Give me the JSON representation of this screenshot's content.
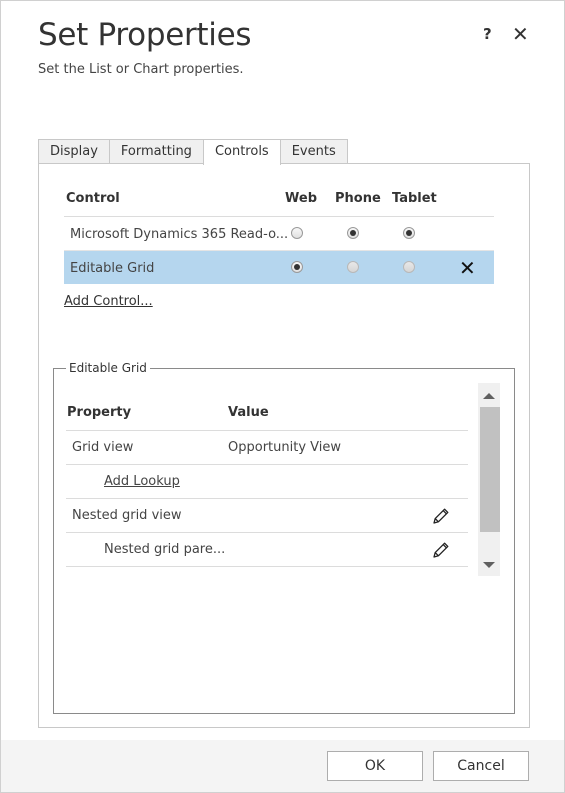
{
  "header": {
    "title": "Set Properties",
    "subtitle": "Set the List or Chart properties.",
    "help_label": "?",
    "close_label": "✕"
  },
  "tabs": [
    {
      "label": "Display",
      "active": false
    },
    {
      "label": "Formatting",
      "active": false
    },
    {
      "label": "Controls",
      "active": true
    },
    {
      "label": "Events",
      "active": false
    }
  ],
  "controls_table": {
    "headers": [
      "Control",
      "Web",
      "Phone",
      "Tablet"
    ],
    "rows": [
      {
        "name": "Microsoft Dynamics 365 Read-o...",
        "web": false,
        "phone": true,
        "tablet": true,
        "selected": false
      },
      {
        "name": "Editable Grid",
        "web": true,
        "phone": false,
        "tablet": false,
        "selected": true
      }
    ],
    "add_control_label": "Add Control..."
  },
  "editable_grid": {
    "legend": "Editable Grid",
    "headers": [
      "Property",
      "Value"
    ],
    "rows": [
      {
        "property": "Grid view",
        "value": "Opportunity View"
      },
      {
        "property": "Add Lookup",
        "value": ""
      },
      {
        "property": "Nested grid view",
        "value": ""
      },
      {
        "property": "Nested grid pare...",
        "value": ""
      }
    ]
  },
  "footer": {
    "ok_label": "OK",
    "cancel_label": "Cancel"
  },
  "icons": {
    "delete": "close-icon",
    "edit": "pencil-icon"
  },
  "colors": {
    "selected_row": "#b5d6ee",
    "footer_bg": "#f4f4f4"
  }
}
